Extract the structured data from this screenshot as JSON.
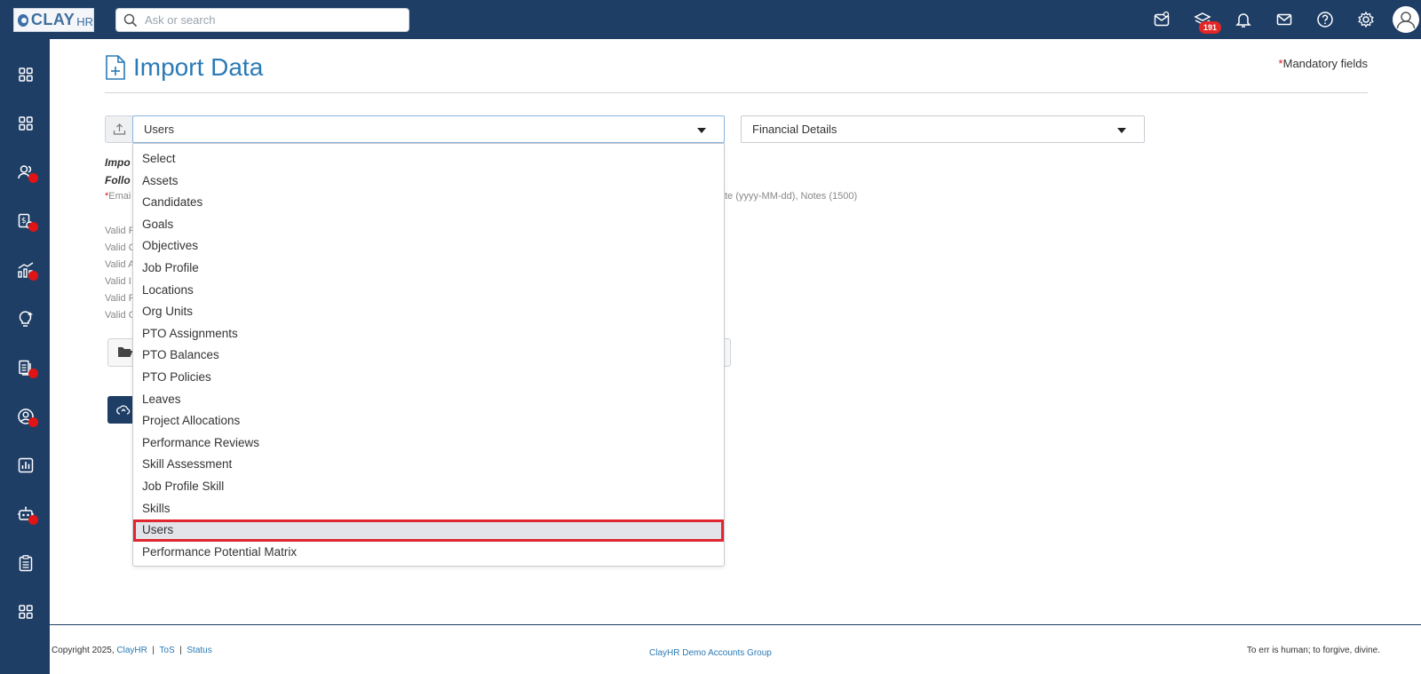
{
  "brand": {
    "logo_text": "CLAY",
    "logo_sub": "HR"
  },
  "search": {
    "placeholder": "Ask or search"
  },
  "topbar": {
    "icons": [
      "clock-mail-icon",
      "layers-icon",
      "bell-icon",
      "mail-icon",
      "help-icon",
      "gear-icon",
      "user-avatar-icon"
    ],
    "layers_badge": "191"
  },
  "sidebar": {
    "items": [
      {
        "icon": "grid-icon",
        "dot": false
      },
      {
        "icon": "grid-icon",
        "dot": false
      },
      {
        "icon": "people-icon",
        "dot": true
      },
      {
        "icon": "payroll-icon",
        "dot": true
      },
      {
        "icon": "analytics-icon",
        "dot": true
      },
      {
        "icon": "lightbulb-icon",
        "dot": false
      },
      {
        "icon": "documents-icon",
        "dot": true
      },
      {
        "icon": "profile-circle-icon",
        "dot": true
      },
      {
        "icon": "report-chart-icon",
        "dot": false
      },
      {
        "icon": "robot-icon",
        "dot": true
      },
      {
        "icon": "clipboard-icon",
        "dot": false
      },
      {
        "icon": "grid-icon",
        "dot": false
      }
    ]
  },
  "page": {
    "title": "Import Data",
    "mandatory_star": "*",
    "mandatory_label": "Mandatory fields"
  },
  "form": {
    "entity_select_value": "Users",
    "secondary_select_value": "Financial Details",
    "hint_line1": "Impo",
    "hint_line2": "Follo",
    "hint_star": "*",
    "hint_line3_start": "Emai",
    "hint_line3_end": "te (yyyy-MM-dd), Notes (1500)",
    "valid_lines": [
      "Valid F",
      "Valid C",
      "Valid A",
      "Valid I",
      "Valid F",
      "Valid C"
    ]
  },
  "dropdown": {
    "options": [
      "Select",
      "Assets",
      "Candidates",
      "Goals",
      "Objectives",
      "Job Profile",
      "Locations",
      "Org Units",
      "PTO Assignments",
      "PTO Balances",
      "PTO Policies",
      "Leaves",
      "Project Allocations",
      "Performance Reviews",
      "Skill Assessment",
      "Job Profile Skill",
      "Skills",
      "Users",
      "Performance Potential Matrix"
    ],
    "selected": "Users"
  },
  "footer": {
    "copyright": "Copyright 2025,",
    "company_link": "ClayHR",
    "sep1": "|",
    "tos_link": "ToS",
    "sep2": "|",
    "status_link": "Status",
    "center_text": "ClayHR Demo Accounts Group",
    "quote": "To err is human; to forgive, divine."
  }
}
